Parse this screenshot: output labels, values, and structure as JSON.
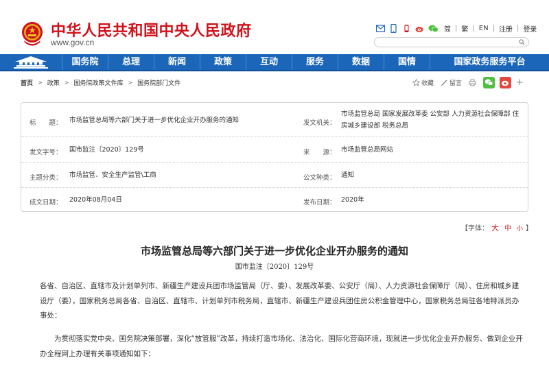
{
  "header": {
    "site_title": "中华人民共和国中央人民政府",
    "site_url": "www.gov.cn",
    "links": [
      "简",
      "繁",
      "EN",
      "注册",
      "登录"
    ],
    "icons": [
      "mail-icon",
      "mobile-icon",
      "phone-icon",
      "weibo-icon",
      "wechat-icon"
    ]
  },
  "search": {
    "placeholder": ""
  },
  "nav": {
    "items": [
      "国务院",
      "总理",
      "新闻",
      "政策",
      "互动",
      "服务",
      "数据",
      "国情",
      "国家政务服务平台"
    ]
  },
  "breadcrumb": [
    "首页",
    "政策",
    "国务院政策文件库",
    "国务院部门文件"
  ],
  "tools": {
    "favorite": "收藏",
    "notes": "留言"
  },
  "info": {
    "title_label": "标　　题：",
    "title_value": "市场监管总局等六部门关于进一步优化企业开办服务的通知",
    "issuer_label": "发文机关：",
    "issuer_value": "市场监管总局 国家发展改革委 公安部 人力资源社会保障部 住房城乡建设部 税务总局",
    "docno_label": "发文字号：",
    "docno_value": "国市监注〔2020〕129号",
    "source_label": "来　　源：",
    "source_value": "市场监管总局网站",
    "topic_label": "主题分类：",
    "topic_value": "市场监管、安全生产监管\\工商",
    "type_label": "公文种类：",
    "type_value": "通知",
    "date_label": "成文日期：",
    "date_value": "2020年08月04日",
    "pub_label": "发布日期：",
    "pub_value": "2020年"
  },
  "fontsize": {
    "prefix": "【字体：",
    "big": "大",
    "mid": "中",
    "small": "小",
    "suffix": "】"
  },
  "article": {
    "title": "市场监管总局等六部门关于进一步优化企业开办服务的通知",
    "doc_number": "国市监注〔2020〕129号",
    "para1": "各省、自治区、直辖市及计划单列市、新疆生产建设兵团市场监管局（厅、委）、发展改革委、公安厅（局）、人力资源社会保障厅（局）、住房和城乡建设厅（委），国家税务总局各省、自治区、直辖市、计划单列市税务局，直辖市、新疆生产建设兵团住房公积金管理中心，国家税务总局驻各地特派员办事处：",
    "para2": "为贯彻落实党中央、国务院决策部署，深化“放管服”改革，持续打造市场化、法治化、国际化营商环境，现就进一步优化企业开办服务、做到企业开办全程网上办理有关事项通知如下："
  },
  "colors": {
    "brand_red": "#d0121b",
    "nav_blue": "#1b66b9",
    "wechat_green": "#4fbf40",
    "weibo_red": "#e2493e"
  }
}
